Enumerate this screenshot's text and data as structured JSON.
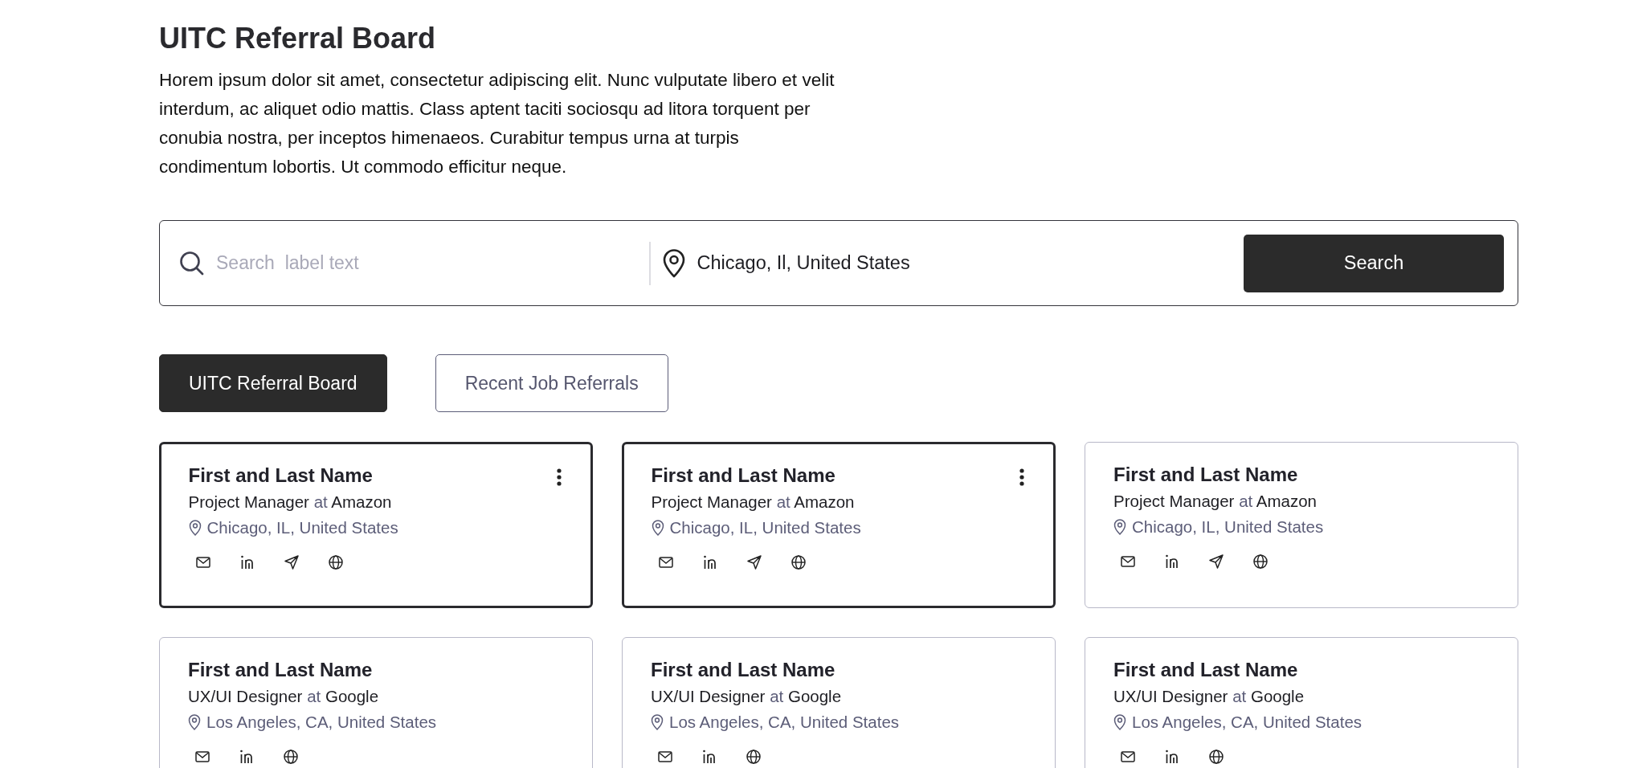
{
  "header": {
    "title": "UITC Referral Board",
    "description": "Horem ipsum dolor sit amet, consectetur adipiscing elit. Nunc vulputate libero et velit interdum, ac aliquet odio mattis. Class aptent taciti sociosqu ad litora torquent per conubia nostra, per inceptos himenaeos. Curabitur tempus urna at turpis condimentum lobortis. Ut commodo efficitur neque."
  },
  "search": {
    "placeholder": "Search  label text",
    "location": "Chicago, Il, United States",
    "button": "Search"
  },
  "tabs": [
    {
      "label": "UITC Referral Board",
      "selected": true
    },
    {
      "label": "Recent Job Referrals",
      "selected": false
    }
  ],
  "cards": [
    {
      "name": "First and Last Name",
      "role": "Project Manager",
      "connector": "at",
      "company": "Amazon",
      "location": "Chicago, IL, United States",
      "selected": true,
      "links": [
        {
          "kind": "mail"
        },
        {
          "kind": "linkedin"
        },
        {
          "kind": "send"
        },
        {
          "kind": "globe"
        }
      ]
    },
    {
      "name": "First and Last Name",
      "role": "Project Manager",
      "connector": "at",
      "company": "Amazon",
      "location": "Chicago, IL, United States",
      "selected": true,
      "links": [
        {
          "kind": "mail"
        },
        {
          "kind": "linkedin"
        },
        {
          "kind": "send"
        },
        {
          "kind": "globe"
        }
      ]
    },
    {
      "name": "First and Last Name",
      "role": "Project Manager",
      "connector": "at",
      "company": "Amazon",
      "location": "Chicago, IL, United States",
      "selected": false,
      "links": [
        {
          "kind": "mail"
        },
        {
          "kind": "linkedin"
        },
        {
          "kind": "send"
        },
        {
          "kind": "globe"
        }
      ]
    },
    {
      "name": "First and Last Name",
      "role": "UX/UI Designer",
      "connector": "at",
      "company": "Google",
      "location": "Los Angeles, CA, United States",
      "selected": false,
      "links": [
        {
          "kind": "mail"
        },
        {
          "kind": "linkedin"
        },
        {
          "kind": "globe"
        }
      ]
    },
    {
      "name": "First and Last Name",
      "role": "UX/UI Designer",
      "connector": "at",
      "company": "Google",
      "location": "Los Angeles, CA, United States",
      "selected": false,
      "links": [
        {
          "kind": "mail"
        },
        {
          "kind": "linkedin"
        },
        {
          "kind": "globe"
        }
      ]
    },
    {
      "name": "First and Last Name",
      "role": "UX/UI Designer",
      "connector": "at",
      "company": "Google",
      "location": "Los Angeles, CA, United States",
      "selected": false,
      "links": [
        {
          "kind": "mail"
        },
        {
          "kind": "linkedin"
        },
        {
          "kind": "globe"
        }
      ]
    }
  ]
}
